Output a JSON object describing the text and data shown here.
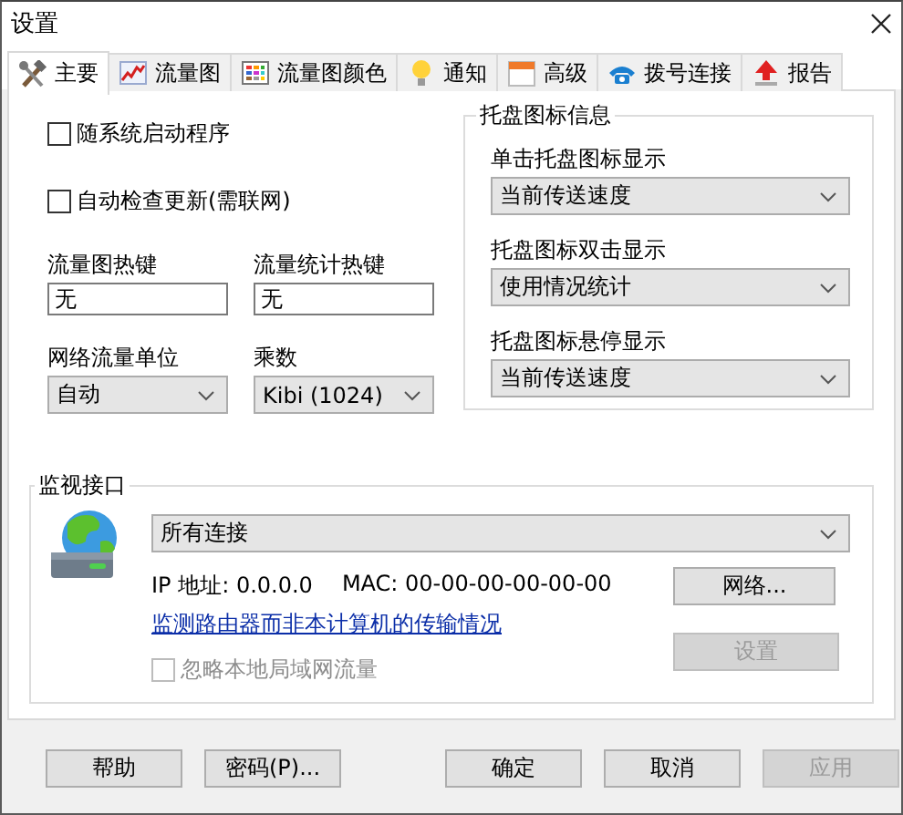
{
  "window": {
    "title": "设置"
  },
  "tabs": [
    {
      "label": "主要",
      "selected": true
    },
    {
      "label": "流量图",
      "selected": false
    },
    {
      "label": "流量图颜色",
      "selected": false
    },
    {
      "label": "通知",
      "selected": false
    },
    {
      "label": "高级",
      "selected": false
    },
    {
      "label": "拨号连接",
      "selected": false
    },
    {
      "label": "报告",
      "selected": false
    }
  ],
  "startup": {
    "label": "随系统启动程序",
    "checked": false
  },
  "auto_update": {
    "label": "自动检查更新(需联网)",
    "checked": false
  },
  "graph_hotkey": {
    "label": "流量图热键",
    "value": "无"
  },
  "stats_hotkey": {
    "label": "流量统计热键",
    "value": "无"
  },
  "unit": {
    "label": "网络流量单位",
    "value": "自动"
  },
  "multiplier": {
    "label": "乘数",
    "value": "Kibi (1024)"
  },
  "tray": {
    "title": "托盘图标信息",
    "items": [
      {
        "label": "单击托盘图标显示",
        "value": "当前传送速度"
      },
      {
        "label": "托盘图标双击显示",
        "value": "使用情况统计"
      },
      {
        "label": "托盘图标悬停显示",
        "value": "当前传送速度"
      }
    ]
  },
  "monitor": {
    "title": "监视接口",
    "interface": "所有连接",
    "ip": "IP 地址: 0.0.0.0",
    "mac": "MAC: 00-00-00-00-00-00",
    "router_link": "监测路由器而非本计算机的传输情况",
    "ignore_lan": {
      "label": "忽略本地局域网流量",
      "checked": false,
      "disabled": true
    },
    "network_button": {
      "label": "网络...",
      "disabled": false
    },
    "settings_button": {
      "label": "设置",
      "disabled": true
    }
  },
  "buttons": [
    {
      "label": "帮助",
      "disabled": false
    },
    {
      "label": "密码(P)...",
      "disabled": false
    },
    {
      "label": "确定",
      "disabled": false
    },
    {
      "label": "取消",
      "disabled": false
    },
    {
      "label": "应用",
      "disabled": true
    }
  ]
}
